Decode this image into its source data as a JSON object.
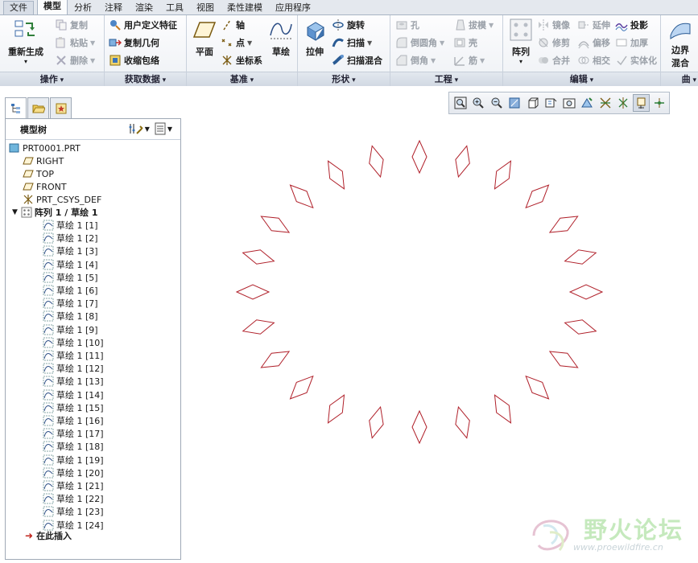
{
  "menu": {
    "file": "文件",
    "tabs": [
      "模型",
      "分析",
      "注释",
      "渲染",
      "工具",
      "视图",
      "柔性建模",
      "应用程序"
    ],
    "active": "模型"
  },
  "ribbon": {
    "operations": {
      "label": "操作",
      "regenerate": "重新生成",
      "copy": "复制",
      "paste": "粘贴",
      "delete": "删除"
    },
    "get_data": {
      "label": "获取数据",
      "user_defined_feature": "用户定义特征",
      "copy_geometry": "复制几何",
      "shrinkwrap": "收缩包络"
    },
    "datum": {
      "label": "基准",
      "plane": "平面",
      "axis": "轴",
      "point": "点",
      "coord_sys": "坐标系",
      "sketch": "草绘"
    },
    "shapes": {
      "label": "形状",
      "extrude": "拉伸",
      "revolve": "旋转",
      "sweep": "扫描",
      "swept_blend": "扫描混合"
    },
    "engineering": {
      "label": "工程",
      "hole": "孔",
      "round": "倒圆角",
      "chamfer": "倒角",
      "draft": "拔模",
      "shell": "壳",
      "rib": "筋"
    },
    "editing": {
      "label": "编辑",
      "pattern": "阵列",
      "mirror": "镜像",
      "trim": "修剪",
      "merge": "合并",
      "extend": "延伸",
      "offset": "偏移",
      "intersect": "相交",
      "project": "投影",
      "thicken": "加厚",
      "solidify": "实体化"
    },
    "surfaces": {
      "boundary_blend_1": "边界",
      "boundary_blend_2": "混合",
      "label_partial": "曲"
    }
  },
  "model_tree": {
    "header": "模型树",
    "root": "PRT0001.PRT",
    "datums": [
      "RIGHT",
      "TOP",
      "FRONT",
      "PRT_CSYS_DEF"
    ],
    "pattern": "阵列 1 / 草绘 1",
    "sketches": [
      "草绘 1 [1]",
      "草绘 1 [2]",
      "草绘 1 [3]",
      "草绘 1 [4]",
      "草绘 1 [5]",
      "草绘 1 [6]",
      "草绘 1 [7]",
      "草绘 1 [8]",
      "草绘 1 [9]",
      "草绘 1 [10]",
      "草绘 1 [11]",
      "草绘 1 [12]",
      "草绘 1 [13]",
      "草绘 1 [14]",
      "草绘 1 [15]",
      "草绘 1 [16]",
      "草绘 1 [17]",
      "草绘 1 [18]",
      "草绘 1 [19]",
      "草绘 1 [20]",
      "草绘 1 [21]",
      "草绘 1 [22]",
      "草绘 1 [23]",
      "草绘 1 [24]"
    ],
    "insert_here": "在此插入"
  },
  "view_toolbar": {
    "icons": [
      "refit-icon",
      "zoom-in-icon",
      "zoom-out-icon",
      "repaint-icon",
      "display-style-icon",
      "saved-views-icon",
      "view-manager-icon",
      "plane-display-icon",
      "axis-display-icon",
      "point-display-icon",
      "csys-display-icon",
      "annotation-display-icon"
    ]
  },
  "graphics": {
    "pattern_count": 24,
    "sketch_color": "#b0202a"
  },
  "watermark": {
    "text": "野火论坛",
    "url": "www.proewildfire.cn"
  }
}
